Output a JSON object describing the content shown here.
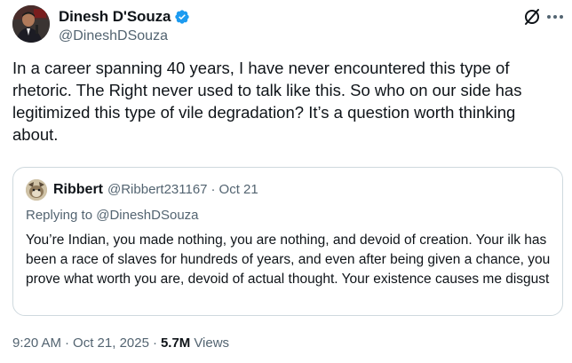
{
  "author": {
    "name": "Dinesh D'Souza",
    "handle": "@DineshDSouza",
    "verified": true,
    "verified_color": "#1d9bf0"
  },
  "icons": {
    "avatar": "avatar",
    "verified": "verified-badge-icon",
    "grok": "grok-icon",
    "more": "more-icon"
  },
  "tweet": {
    "text": "In a career spanning 40 years, I have never encountered this type of rhetoric. The Right never used to talk like this. So who on our side has legitimized this type of vile degradation? It’s a question worth thinking about."
  },
  "quoted": {
    "name": "Ribbert",
    "handle": "@Ribbert231167",
    "separator": "·",
    "date": "Oct 21",
    "replying_prefix": "Replying to ",
    "replying_to": "@DineshDSouza",
    "text": "You’re Indian, you made nothing, you are nothing, and devoid of creation. Your ilk has been a race of slaves for hundreds of years, and even after being given a chance, you prove what worth you are, devoid of actual thought. Your existence causes me disgust"
  },
  "meta": {
    "time": "9:20 AM",
    "separator1": "·",
    "date": "Oct 21, 2025",
    "separator2": "·",
    "views_count": "5.7M",
    "views_label": "Views"
  },
  "colors": {
    "text_primary": "#0f1419",
    "text_secondary": "#536471",
    "border": "#cfd9de",
    "accent": "#1d9bf0"
  }
}
